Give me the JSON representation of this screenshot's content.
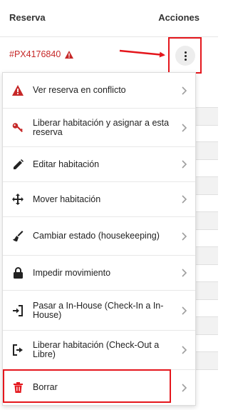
{
  "table": {
    "col_reserva": "Reserva",
    "col_acciones": "Acciones"
  },
  "row": {
    "reserva_code": "#PX4176840"
  },
  "menu": {
    "items": [
      {
        "label": "Ver reserva en conflicto",
        "icon": "warning-icon"
      },
      {
        "label": "Liberar habitación y asignar a esta reserva",
        "icon": "key-icon"
      },
      {
        "label": "Editar habitación",
        "icon": "pencil-icon"
      },
      {
        "label": "Mover habitación",
        "icon": "move-arrows-icon"
      },
      {
        "label": "Cambiar estado (housekeeping)",
        "icon": "broom-icon"
      },
      {
        "label": "Impedir movimiento",
        "icon": "lock-icon"
      },
      {
        "label": "Pasar a In-House (Check-In a In-House)",
        "icon": "sign-in-icon"
      },
      {
        "label": "Liberar habitación (Check-Out a Libre)",
        "icon": "sign-out-icon"
      },
      {
        "label": "Borrar",
        "icon": "trash-icon"
      }
    ]
  },
  "colors": {
    "danger": "#c62828",
    "annotation_red": "#e4161c",
    "chevron": "#9e9e9e"
  }
}
